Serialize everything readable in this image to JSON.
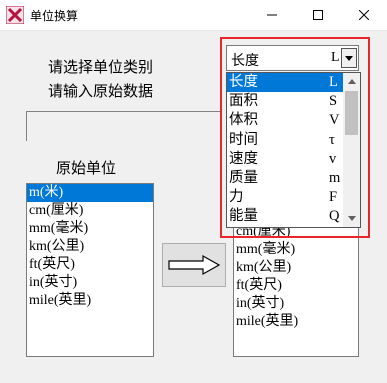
{
  "window": {
    "title": "单位换算",
    "icon": "red-x-app-icon"
  },
  "controls": {
    "minimize": "minimize-icon",
    "maximize": "maximize-icon",
    "close": "close-icon"
  },
  "labels": {
    "select_category": "请选择单位类别",
    "input_data": "请输入原始数据",
    "source_unit": "原始单位"
  },
  "category_combo": {
    "selected_name": "长度",
    "selected_symbol": "L"
  },
  "category_options": [
    {
      "name": "长度",
      "symbol": "L"
    },
    {
      "name": "面积",
      "symbol": "S"
    },
    {
      "name": "体积",
      "symbol": "V"
    },
    {
      "name": "时间",
      "symbol": "τ"
    },
    {
      "name": "速度",
      "symbol": "v"
    },
    {
      "name": "质量",
      "symbol": "m"
    },
    {
      "name": "力",
      "symbol": "F"
    },
    {
      "name": "能量",
      "symbol": "Q"
    }
  ],
  "source_units": [
    "m(米)",
    "cm(厘米)",
    "mm(毫米)",
    "km(公里)",
    "ft(英尺)",
    "in(英寸)",
    "mile(英里)"
  ],
  "target_units": [
    "cm(厘米)",
    "mm(毫米)",
    "km(公里)",
    "ft(英尺)",
    "in(英寸)",
    "mile(英里)"
  ],
  "convert_button": {
    "icon": "right-arrow-icon"
  },
  "colors": {
    "selection": "#0078d7",
    "highlight_box": "#e8262b"
  }
}
